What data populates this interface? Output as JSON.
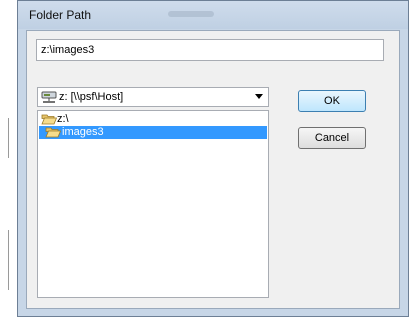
{
  "window": {
    "title": "Folder Path"
  },
  "path_field": {
    "value": "z:\\images3"
  },
  "drive_select": {
    "selected": "z: [\\\\psf\\Host]",
    "icon": "network-drive-icon"
  },
  "folders": [
    {
      "label": "z:\\",
      "icon": "open-folder-icon",
      "selected": false
    },
    {
      "label": "images3",
      "icon": "open-folder-icon",
      "selected": true
    }
  ],
  "buttons": {
    "ok_label": "OK",
    "cancel_label": "Cancel"
  },
  "colors": {
    "selection": "#3399ff",
    "frame": "#c7d6e7",
    "default_button": "#bee6fd"
  }
}
